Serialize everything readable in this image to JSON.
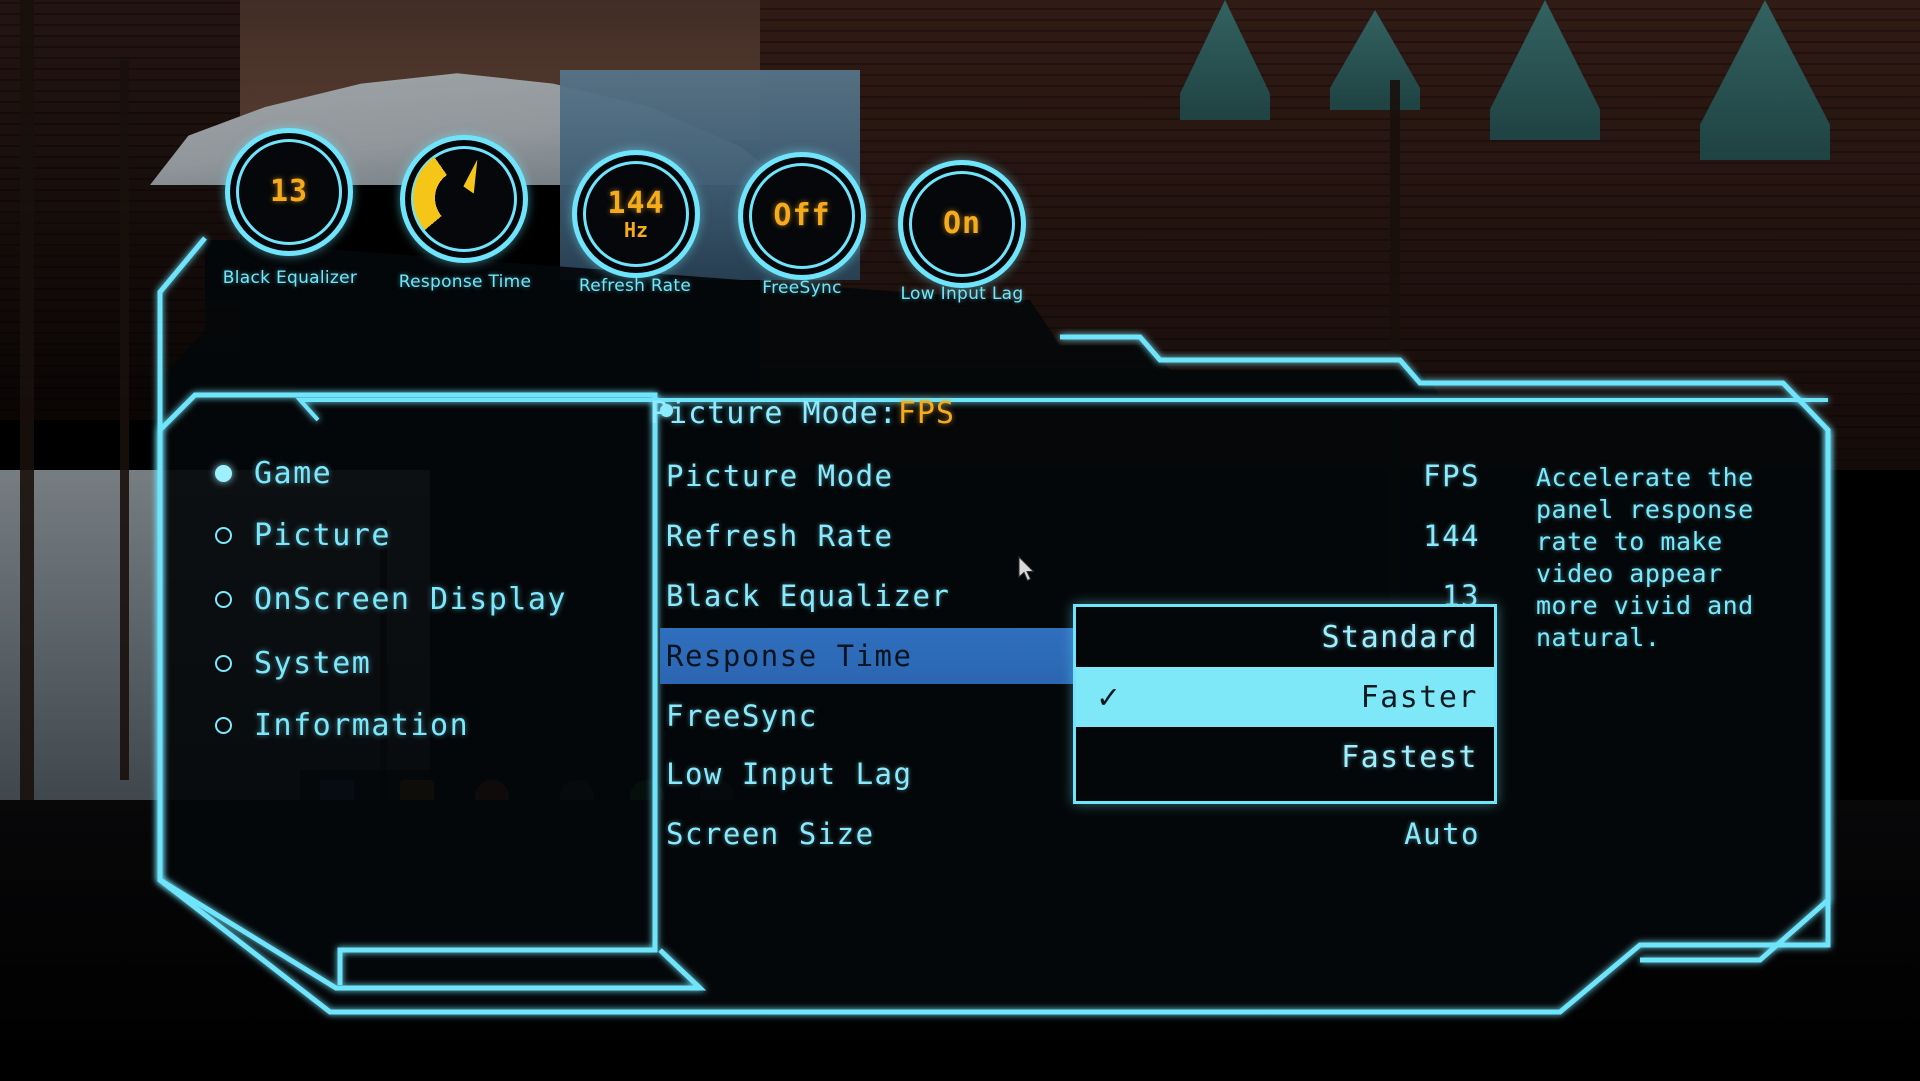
{
  "osd": {
    "title_label": "Picture Mode:",
    "title_value": "FPS",
    "gauges": [
      {
        "name": "black-equalizer",
        "label": "Black Equalizer",
        "value": "13",
        "unit": ""
      },
      {
        "name": "response-time",
        "label": "Response Time",
        "value": "",
        "unit": ""
      },
      {
        "name": "refresh-rate",
        "label": "Refresh Rate",
        "value": "144",
        "unit": "Hz"
      },
      {
        "name": "freesync",
        "label": "FreeSync",
        "value": "Off",
        "unit": ""
      },
      {
        "name": "low-input-lag",
        "label": "Low Input Lag",
        "value": "On",
        "unit": ""
      }
    ],
    "sidebar": [
      {
        "label": "Game",
        "selected": true
      },
      {
        "label": "Picture",
        "selected": false
      },
      {
        "label": "OnScreen Display",
        "selected": false
      },
      {
        "label": "System",
        "selected": false
      },
      {
        "label": "Information",
        "selected": false
      }
    ],
    "settings": [
      {
        "label": "Picture Mode",
        "value": "FPS",
        "selected": false
      },
      {
        "label": "Refresh Rate",
        "value": "144",
        "selected": false
      },
      {
        "label": "Black Equalizer",
        "value": "13",
        "selected": false
      },
      {
        "label": "Response Time",
        "value": "",
        "selected": true
      },
      {
        "label": "FreeSync",
        "value": "",
        "selected": false
      },
      {
        "label": "Low Input Lag",
        "value": "",
        "selected": false
      },
      {
        "label": "Screen Size",
        "value": "Auto",
        "selected": false
      }
    ],
    "dropdown": {
      "options": [
        {
          "label": "Standard",
          "checked": false
        },
        {
          "label": "Faster",
          "checked": true
        },
        {
          "label": "Fastest",
          "checked": false
        }
      ],
      "check_glyph": "✓"
    },
    "description": "Accelerate the\npanel response\nrate to make\nvideo appear\nmore vivid and\nnatural.",
    "colors": {
      "accent_cyan": "#6fe4fa",
      "value_amber": "#f5ab1b",
      "row_highlight": "#2f6fbe",
      "dropdown_highlight": "#7fe8f8",
      "panel_bg": "#04070a"
    }
  }
}
